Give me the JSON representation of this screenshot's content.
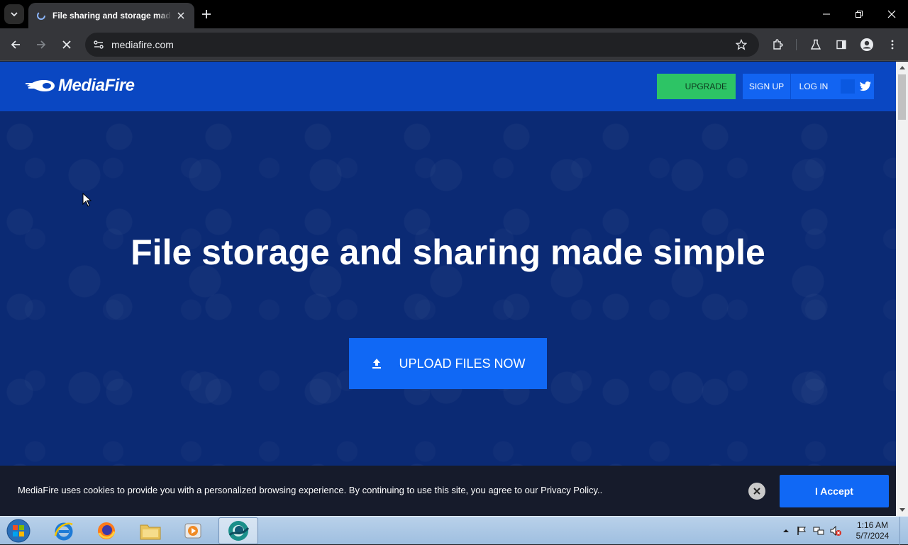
{
  "browser": {
    "tab": {
      "title": "File sharing and storage made simple"
    },
    "new_tab_label": "+",
    "address": "mediafire.com"
  },
  "site": {
    "logo_text": "MediaFire",
    "nav": {
      "upgrade": "UPGRADE",
      "signup": "SIGN UP",
      "login": "LOG IN"
    },
    "hero": {
      "title": "File storage and sharing made simple",
      "upload_button": "UPLOAD FILES NOW"
    },
    "cookie": {
      "text": "MediaFire uses cookies to provide you with a personalized browsing experience. By continuing to use this site, you agree to our Privacy Policy..",
      "accept": "I Accept"
    },
    "colors": {
      "header_bg": "#0a47c2",
      "hero_bg": "#0b2a74",
      "upgrade_green": "#2dc465",
      "accent_blue": "#1068f5"
    }
  },
  "taskbar": {
    "apps": [
      "start-orb-icon",
      "internet-explorer-icon",
      "firefox-icon",
      "file-explorer-icon",
      "media-player-icon",
      "chrome-icon"
    ],
    "clock": {
      "time": "1:16 AM",
      "date": "5/7/2024"
    }
  }
}
